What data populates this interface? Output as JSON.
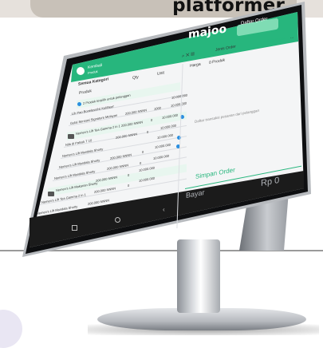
{
  "banner": {
    "text": "platformer"
  },
  "app": {
    "brand": "majoo",
    "order_button": "Daftar Order",
    "back_label": "Kembali",
    "back_sub": "Produk",
    "order_type": "Jenis Order",
    "add_customer": "+ Pelanggan",
    "more": "...",
    "category": "Semua Kategori",
    "col_qty": "Qty",
    "col_unit": "Unit",
    "col_product": "Produk",
    "col_harga": "Harga",
    "product_count": "0 Produk",
    "list_note": "2 Produk terpilih untuk pelanggan",
    "rows": [
      {
        "name": "Lih Pao Boneless/Isi Kol/Beef",
        "price": "10.000.000"
      },
      {
        "name": "Gulai Sensasi Signature Melayan",
        "qty": "200.000 NNNN",
        "unit": "1000",
        "price": "10.000.000"
      },
      {
        "name": "Nemen's Lift Tea Gamma 2 in 1",
        "qty": "200.000 NNNN",
        "unit": "0",
        "price": "10.000.000"
      },
      {
        "name": "Nila di Palsuk T 10",
        "qty": "200.000 NNNN",
        "unit": "0",
        "price": "10.000.000"
      },
      {
        "name": "Nemen's Lift Mandala Shorty",
        "qty": "200.000 NNNN",
        "unit": "0",
        "price": "10.000.000"
      },
      {
        "name": "Nemen's Lift Mandala Shorty",
        "qty": "200.000 NNNN",
        "unit": "0",
        "price": "10.000.000"
      },
      {
        "name": "Nemen's Lift Mandala Shorty",
        "qty": "200.000 NNNN",
        "unit": "0",
        "price": "10.000.000"
      },
      {
        "name": "Nemen's Lift Makanan Shorty",
        "qty": "200.000 NNNN",
        "unit": "0",
        "price": "10.000.000"
      },
      {
        "name": "Nemen's Lift Tea Gamma 2 in 1",
        "qty": "200.000 NNNN",
        "unit": "0",
        "price": "10.000.000"
      },
      {
        "name": "Nemen's Lift Mandala Shorty",
        "qty": "200.000 NNNN",
        "unit": "0",
        "price": "10.000.000"
      }
    ],
    "empty_note": "Daftar transaksi pesanan dari pelanggan",
    "simpan": "Simpan Order",
    "bayar": "Bayar",
    "total": "Rp 0"
  }
}
